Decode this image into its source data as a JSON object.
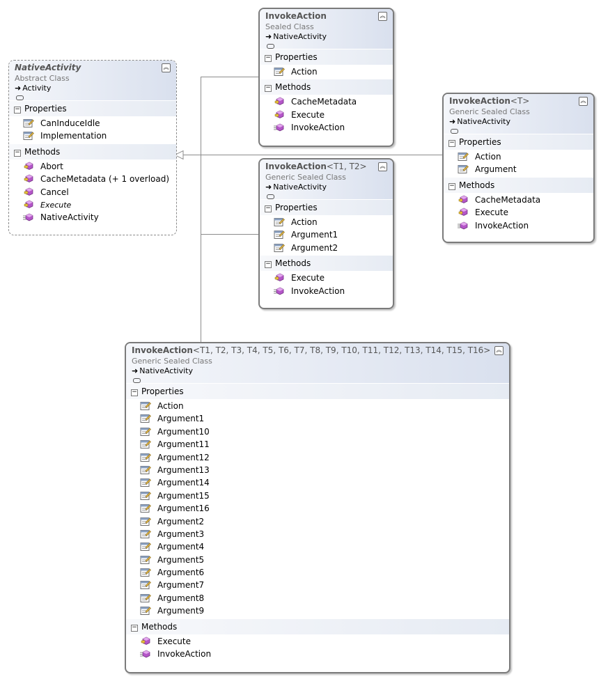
{
  "classes": {
    "native_activity": {
      "name": "NativeActivity",
      "kind": "Abstract Class",
      "base": "Activity",
      "properties_label": "Properties",
      "properties": [
        "CanInduceIdle",
        "Implementation"
      ],
      "methods_label": "Methods",
      "methods": [
        "Abort",
        "CacheMetadata (+ 1 overload)",
        "Cancel",
        "Execute",
        "NativeActivity"
      ]
    },
    "invoke_action": {
      "name": "InvokeAction",
      "kind": "Sealed Class",
      "base": "NativeActivity",
      "properties_label": "Properties",
      "properties": [
        "Action"
      ],
      "methods_label": "Methods",
      "methods": [
        "CacheMetadata",
        "Execute",
        "InvokeAction"
      ]
    },
    "invoke_action_t": {
      "name": "InvokeAction",
      "type_params": "<T>",
      "kind": "Generic Sealed Class",
      "base": "NativeActivity",
      "properties_label": "Properties",
      "properties": [
        "Action",
        "Argument"
      ],
      "methods_label": "Methods",
      "methods": [
        "CacheMetadata",
        "Execute",
        "InvokeAction"
      ]
    },
    "invoke_action_t1_t2": {
      "name": "InvokeAction",
      "type_params": "<T1, T2>",
      "kind": "Generic Sealed Class",
      "base": "NativeActivity",
      "properties_label": "Properties",
      "properties": [
        "Action",
        "Argument1",
        "Argument2"
      ],
      "methods_label": "Methods",
      "methods": [
        "Execute",
        "InvokeAction"
      ]
    },
    "invoke_action_t16": {
      "name": "InvokeAction",
      "type_params": "<T1, T2, T3, T4, T5, T6, T7, T8, T9, T10, T11, T12, T13, T14, T15, T16>",
      "kind": "Generic Sealed Class",
      "base": "NativeActivity",
      "properties_label": "Properties",
      "properties": [
        "Action",
        "Argument1",
        "Argument10",
        "Argument11",
        "Argument12",
        "Argument13",
        "Argument14",
        "Argument15",
        "Argument16",
        "Argument2",
        "Argument3",
        "Argument4",
        "Argument5",
        "Argument6",
        "Argument7",
        "Argument8",
        "Argument9"
      ],
      "methods_label": "Methods",
      "methods": [
        "Execute",
        "InvokeAction"
      ]
    }
  },
  "icons": {
    "property": "property-icon",
    "method_protected_override": "protected-method-icon",
    "constructor": "constructor-icon"
  }
}
